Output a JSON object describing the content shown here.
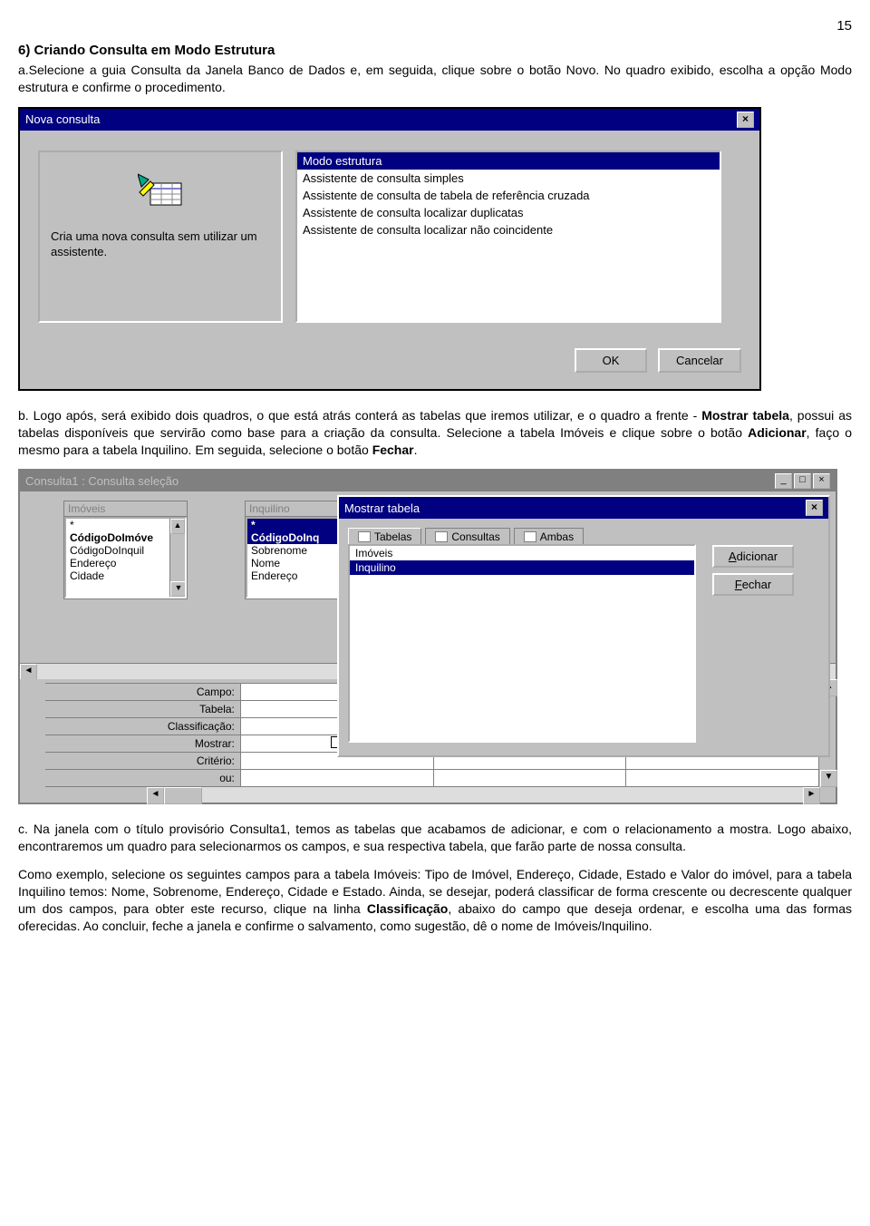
{
  "page_num": "15",
  "heading": "6) Criando Consulta em Modo Estrutura",
  "para_a": "a.Selecione a guia Consulta da Janela Banco de Dados e, em seguida, clique sobre o botão Novo. No quadro exibido, escolha a opção Modo estrutura e confirme o procedimento.",
  "dlg1": {
    "title": "Nova consulta",
    "desc": "Cria uma nova consulta sem utilizar um assistente.",
    "options": [
      "Modo estrutura",
      "Assistente de consulta simples",
      "Assistente de consulta de tabela de referência cruzada",
      "Assistente de consulta localizar duplicatas",
      "Assistente de consulta localizar não coincidente"
    ],
    "ok": "OK",
    "cancel": "Cancelar"
  },
  "para_b_1": "b. Logo após, será exibido dois quadros, o que está atrás conterá as tabelas que iremos utilizar, e o quadro a frente - ",
  "para_b_bold1": "Mostrar tabela",
  "para_b_2": ", possui as tabelas disponíveis que servirão como base para a criação da consulta. Selecione a tabela Imóveis e clique sobre o botão ",
  "para_b_bold2": "Adicionar",
  "para_b_3": ", faço o mesmo para a tabela Inquilino. Em seguida, selecione o botão ",
  "para_b_bold3": "Fechar",
  "para_b_4": ".",
  "qwin": {
    "title": "Consulta1 : Consulta seleção",
    "tbl1": {
      "name": "Imóveis",
      "fields": [
        "*",
        "CódigoDoImóve",
        "CódigoDoInquil",
        "Endereço",
        "Cidade"
      ]
    },
    "tbl2": {
      "name": "Inquilino",
      "fields": [
        "*",
        "CódigoDoInq",
        "Sobrenome",
        "Nome",
        "Endereço"
      ]
    },
    "gridlabels": [
      "Campo:",
      "Tabela:",
      "Classificação:",
      "Mostrar:",
      "Critério:",
      "ou:"
    ]
  },
  "showtbl": {
    "title": "Mostrar tabela",
    "tabs": [
      "Tabelas",
      "Consultas",
      "Ambas"
    ],
    "items": [
      "Imóveis",
      "Inquilino"
    ],
    "add": "Adicionar",
    "close": "Fechar"
  },
  "para_c_1": "c. Na janela com o título provisório Consulta1, temos as tabelas que acabamos de adicionar, e com o relacionamento a mostra. Logo abaixo, encontraremos um quadro para selecionarmos os campos, e sua respectiva tabela, que farão parte de nossa consulta.",
  "para_c_2": "Como exemplo, selecione os seguintes campos para a tabela Imóveis: Tipo de Imóvel, Endereço, Cidade, Estado e Valor do imóvel, para a tabela Inquilino temos: Nome, Sobrenome, Endereço, Cidade e Estado. Ainda, se desejar, poderá classificar de forma crescente ou decrescente qualquer um dos campos, para obter este recurso, clique na linha ",
  "para_c_bold": "Classificação",
  "para_c_3": ", abaixo do campo que deseja ordenar, e escolha uma das formas oferecidas. Ao concluir, feche a janela e confirme o salvamento, como sugestão, dê o nome de Imóveis/Inquilino."
}
